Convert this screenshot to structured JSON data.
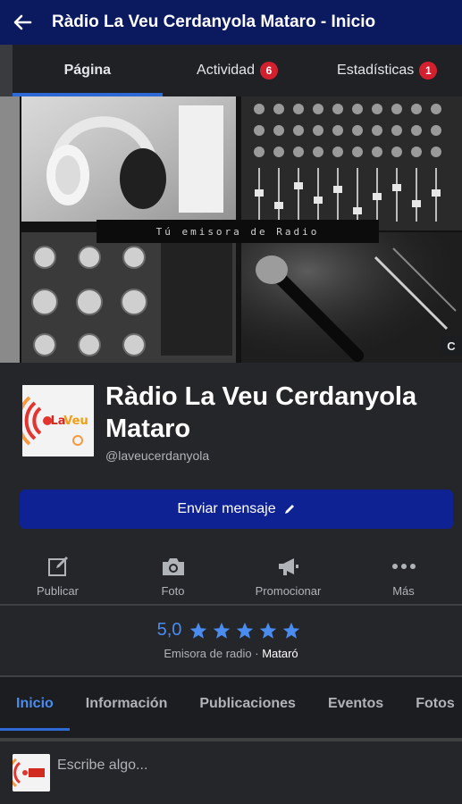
{
  "topbar": {
    "title": "Ràdio La Veu Cerdanyola Mataro - Inicio"
  },
  "tabs": [
    {
      "label": "Página"
    },
    {
      "label": "Actividad",
      "badge": "6"
    },
    {
      "label": "Estadísticas",
      "badge": "1"
    }
  ],
  "cover": {
    "caption": "Tú emisora de Radio",
    "cam_glyph": "C"
  },
  "profile": {
    "name": "Ràdio La Veu Cerdanyola Mataro",
    "handle": "@laveucerdanyola",
    "logo_text": "LaVeu"
  },
  "message_button": {
    "label": "Enviar mensaje"
  },
  "actions": [
    {
      "label": "Publicar",
      "icon": "edit-icon"
    },
    {
      "label": "Foto",
      "icon": "camera-icon"
    },
    {
      "label": "Promocionar",
      "icon": "megaphone-icon"
    },
    {
      "label": "Más",
      "icon": "more-icon"
    }
  ],
  "rating": {
    "score": "5,0",
    "stars": 5,
    "category": "Emisora de radio",
    "separator": " · ",
    "city": "Mataró"
  },
  "nav": [
    {
      "label": "Inicio"
    },
    {
      "label": "Información"
    },
    {
      "label": "Publicaciones"
    },
    {
      "label": "Eventos"
    },
    {
      "label": "Fotos"
    }
  ],
  "compose": {
    "placeholder": "Escribe algo..."
  },
  "colors": {
    "header": "#0b1a5e",
    "accent": "#2d6ad6",
    "button": "#0f2294",
    "badge": "#d3202f",
    "star": "#4a8cf0"
  }
}
